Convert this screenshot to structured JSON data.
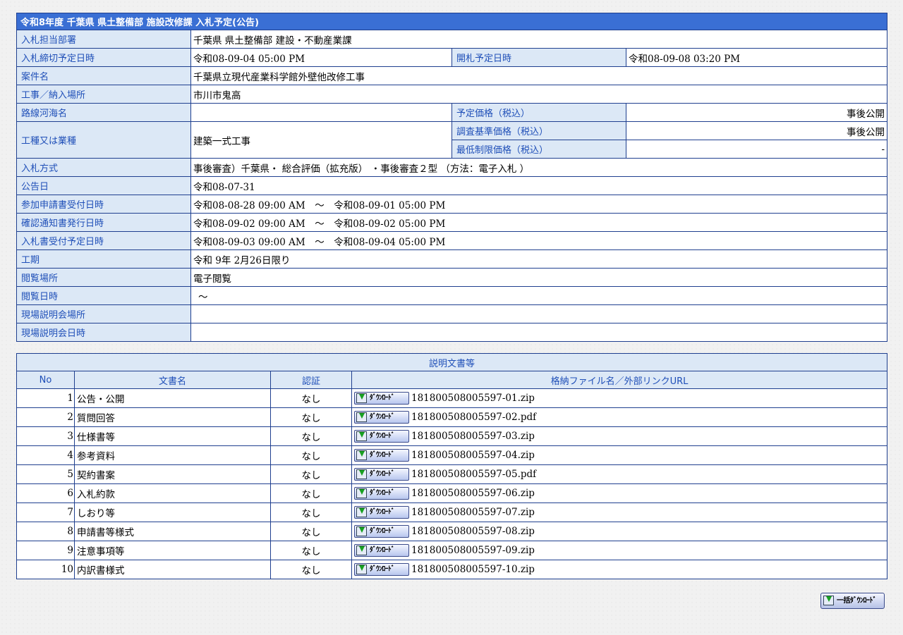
{
  "notice": {
    "title": "令和8年度 千葉県 県土整備部 施設改修課 入札予定(公告)",
    "labels": {
      "dept": "入札担当部署",
      "deadline": "入札締切予定日時",
      "opening": "開札予定日時",
      "project": "案件名",
      "location": "工事／納入場所",
      "route": "路線河海名",
      "planned_price": "予定価格（税込）",
      "category": "工種又は業種",
      "survey_price": "調査基準価格（税込）",
      "min_price": "最低制限価格（税込）",
      "method": "入札方式",
      "announce_date": "公告日",
      "app_period": "参加申請書受付日時",
      "confirm_period": "確認通知書発行日時",
      "bid_period": "入札書受付予定日時",
      "work_period": "工期",
      "view_place": "閲覧場所",
      "view_time": "閲覧日時",
      "briefing_place": "現場説明会場所",
      "briefing_time": "現場説明会日時"
    },
    "values": {
      "dept": "千葉県 県土整備部 建設・不動産業課",
      "deadline": "令和08-09-04 05:00 PM",
      "opening": "令和08-09-08 03:20 PM",
      "project": "千葉県立現代産業科学館外壁他改修工事",
      "location": "市川市鬼高",
      "route": "",
      "planned_price": "事後公開",
      "category": "建築一式工事",
      "survey_price": "事後公開",
      "min_price": "-",
      "method": "事後審査）千葉県・ 総合評価（拡充版） ・事後審査２型 （方法：電子入札 ）",
      "announce_date": "令和08-07-31",
      "app_period": "令和08-08-28 09:00 AM　～　令和08-09-01 05:00 PM",
      "confirm_period": "令和08-09-02 09:00 AM　～　令和08-09-02 05:00 PM",
      "bid_period": "令和08-09-03 09:00 AM　～　令和08-09-04 05:00 PM",
      "work_period": "令和 9年 2月26日限り",
      "view_place": "電子閲覧",
      "view_time": "～",
      "briefing_place": "",
      "briefing_time": ""
    }
  },
  "documents": {
    "title": "説明文書等",
    "columns": [
      "No",
      "文書名",
      "認証",
      "格納ファイル名／外部リンクURL"
    ],
    "download_label": "ﾀﾞｳﾝﾛｰﾄﾞ",
    "rows": [
      {
        "no": "1",
        "name": "公告・公開",
        "auth": "なし",
        "file": "181800508005597-01.zip"
      },
      {
        "no": "2",
        "name": "質問回答",
        "auth": "なし",
        "file": "181800508005597-02.pdf"
      },
      {
        "no": "3",
        "name": "仕様書等",
        "auth": "なし",
        "file": "181800508005597-03.zip"
      },
      {
        "no": "4",
        "name": "参考資料",
        "auth": "なし",
        "file": "181800508005597-04.zip"
      },
      {
        "no": "5",
        "name": "契約書案",
        "auth": "なし",
        "file": "181800508005597-05.pdf"
      },
      {
        "no": "6",
        "name": "入札約款",
        "auth": "なし",
        "file": "181800508005597-06.zip"
      },
      {
        "no": "7",
        "name": "しおり等",
        "auth": "なし",
        "file": "181800508005597-07.zip"
      },
      {
        "no": "8",
        "name": "申請書等様式",
        "auth": "なし",
        "file": "181800508005597-08.zip"
      },
      {
        "no": "9",
        "name": "注意事項等",
        "auth": "なし",
        "file": "181800508005597-09.zip"
      },
      {
        "no": "10",
        "name": "内訳書様式",
        "auth": "なし",
        "file": "181800508005597-10.zip"
      }
    ]
  },
  "bulk_download_label": "一括ﾀﾞｳﾝﾛｰﾄﾞ",
  "icons": {
    "download": "download-arrow-icon"
  }
}
